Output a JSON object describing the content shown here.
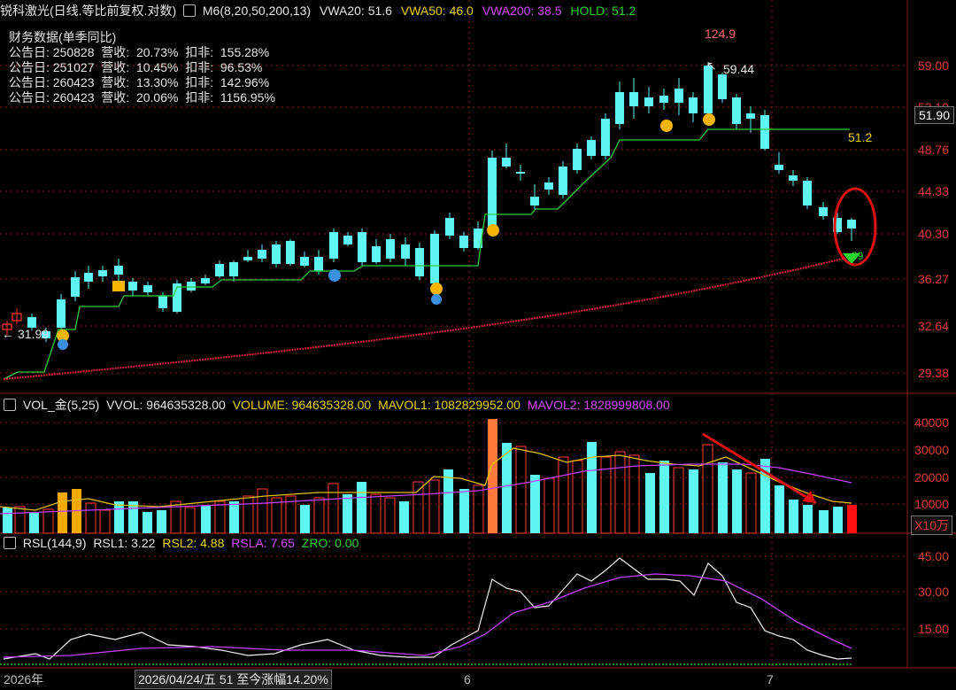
{
  "main_header": {
    "title": "锐科激光(日线.等比前复权.对数)",
    "ma_label": "M6(8,20,50,200,13)",
    "vwa20": "VWA20: 51.6",
    "vwa50": "VWA50: 46.0",
    "vwa200": "VWA200: 38.5",
    "hold": "HOLD: 51.2"
  },
  "financials": {
    "title": "财务数据(单季同比)",
    "rows": [
      {
        "date": "公告日: 250828",
        "rev": "营收:  20.73%",
        "np": "扣非:  155.28%"
      },
      {
        "date": "公告日: 251027",
        "rev": "营收:  10.45%",
        "np": "扣非:  96.53%"
      },
      {
        "date": "公告日: 260423",
        "rev": "营收:  13.30%",
        "np": "扣非:  142.96%"
      },
      {
        "date": "公告日: 260423",
        "rev": "营收:  20.06%",
        "np": "扣非:  1156.95%"
      }
    ]
  },
  "price_axis": [
    "59.00",
    "53.10",
    "48.76",
    "44.33",
    "40.30",
    "36.27",
    "32.64",
    "29.38"
  ],
  "current_price": "51.90",
  "annotations": {
    "high_label": "124.9",
    "high_price": "59.44",
    "low_price": "31.99",
    "hold_value": "51.2",
    "last_marker": "39"
  },
  "volume_header": {
    "label": "VOL_金(5,25)",
    "vvol": "VVOL: 964635328.00",
    "volume": "VOLUME: 964635328.00",
    "mavol1": "MAVOL1: 1082829952.00",
    "mavol2": "MAVOL2: 1828999808.00"
  },
  "volume_axis": [
    "40000",
    "30000",
    "20000",
    "10000"
  ],
  "volume_unit": "X10万",
  "rsl_header": {
    "label": "RSL(144,9)",
    "rsl1": "RSL1: 3.22",
    "rsl2": "RSL2: 4.88",
    "rsla": "RSLA: 7.65",
    "zro": "ZRO: 0.00"
  },
  "rsl_axis": [
    "45.00",
    "30.00",
    "15.00"
  ],
  "x_axis": {
    "year": "2026年",
    "cursor_date": "2026/04/24/五 51 至今涨幅14.20%",
    "m6": "6",
    "m7": "7"
  },
  "colors": {
    "up": "#ff3b3b",
    "down": "#5ff5f5",
    "hold_line": "#2ecc40",
    "vwa200": "#e0203a",
    "grid": "#8b1a1a"
  }
}
